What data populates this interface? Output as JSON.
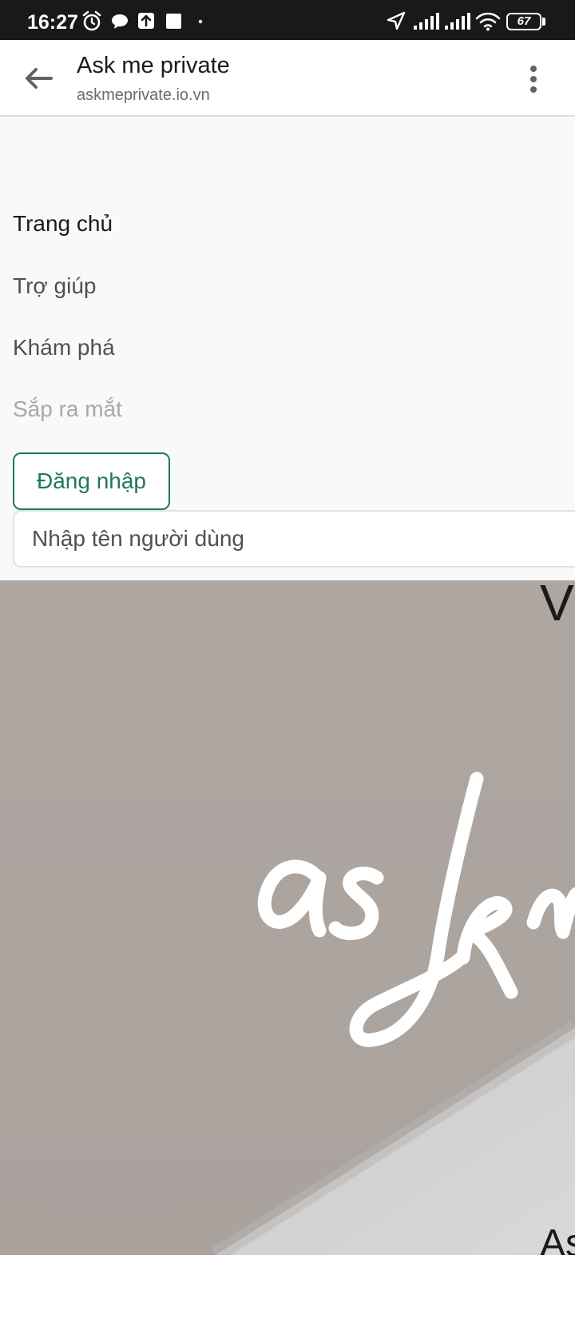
{
  "status_bar": {
    "time": "16:27",
    "battery": "67",
    "icons": [
      "alarm-icon",
      "chat-bubble-icon",
      "upload-icon",
      "square-icon",
      "dot-icon",
      "navigation-icon",
      "signal-icon",
      "signal-icon",
      "wifi-icon",
      "battery-icon"
    ]
  },
  "app_bar": {
    "title": "Ask me private",
    "url": "askmeprivate.io.vn",
    "back_icon": "arrow-left-icon",
    "menu_icon": "more-vert-icon"
  },
  "nav": {
    "items": [
      {
        "label": "Trang chủ",
        "state": "active"
      },
      {
        "label": "Trợ giúp",
        "state": "normal"
      },
      {
        "label": "Khám phá",
        "state": "normal"
      },
      {
        "label": "Sắp ra mắt",
        "state": "disabled"
      }
    ]
  },
  "login": {
    "button_label": "Đăng nhập",
    "username_placeholder": "Nhập tên người dùng"
  },
  "hero": {
    "top_text": "V",
    "script_text": "askm",
    "bottom_text": "As"
  },
  "colors": {
    "accent": "#1f7a52",
    "status_bar": "#17191a",
    "content_bg": "#f8f9fa",
    "hero_bg": "#aea7a2"
  }
}
